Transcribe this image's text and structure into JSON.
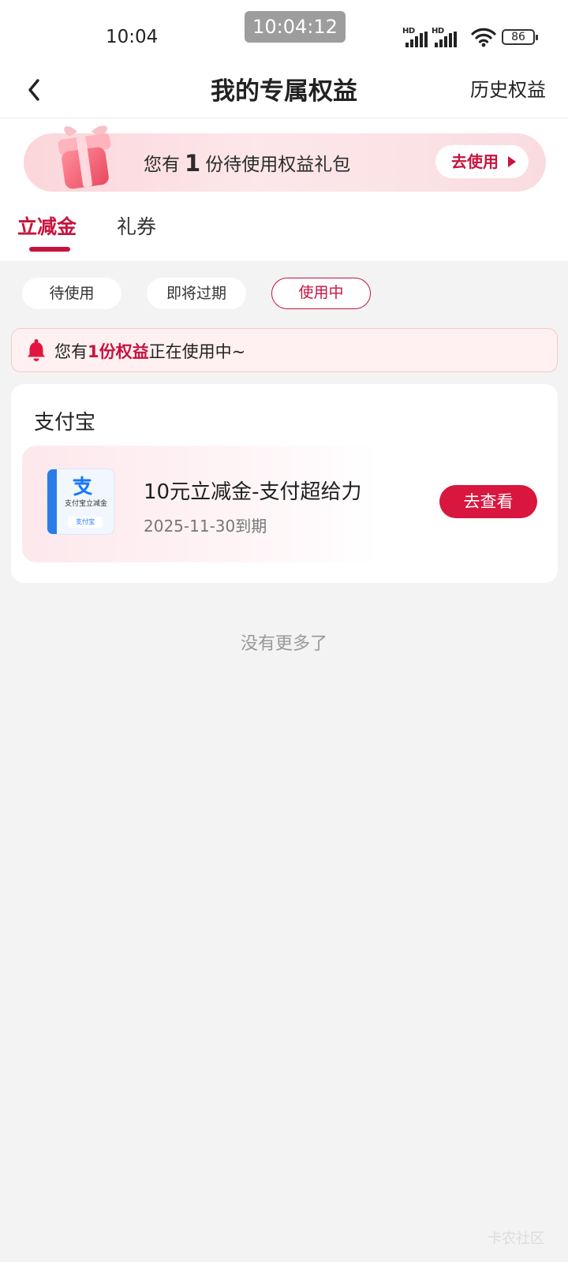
{
  "status_bar": {
    "time": "10:04",
    "overlay_time": "10:04:12",
    "signal_1_label": "HD",
    "signal_2_label": "HD",
    "battery": "86"
  },
  "header": {
    "title": "我的专属权益",
    "history_label": "历史权益"
  },
  "gift_banner": {
    "prefix": "您有",
    "count": "1",
    "suffix": "份待使用权益礼包",
    "button_label": "去使用"
  },
  "tabs": [
    {
      "label": "立减金",
      "active": true
    },
    {
      "label": "礼券",
      "active": false
    }
  ],
  "filters": [
    {
      "label": "待使用",
      "active": false
    },
    {
      "label": "即将过期",
      "active": false
    },
    {
      "label": "使用中",
      "active": true
    }
  ],
  "notice": {
    "prefix": "您有",
    "highlight": "1份权益",
    "suffix": "正在使用中~"
  },
  "section": {
    "title": "支付宝",
    "coupon": {
      "name": "10元立减金-支付超给力",
      "expiry": "2025-11-30到期",
      "thumb_label": "支付宝立减金",
      "thumb_brand": "支付宝",
      "button_label": "去查看"
    }
  },
  "footer": {
    "no_more": "没有更多了",
    "watermark": "卡农社区"
  },
  "colors": {
    "accent": "#c8133f",
    "button_red": "#d8163e",
    "page_bg": "#f3f3f3"
  }
}
